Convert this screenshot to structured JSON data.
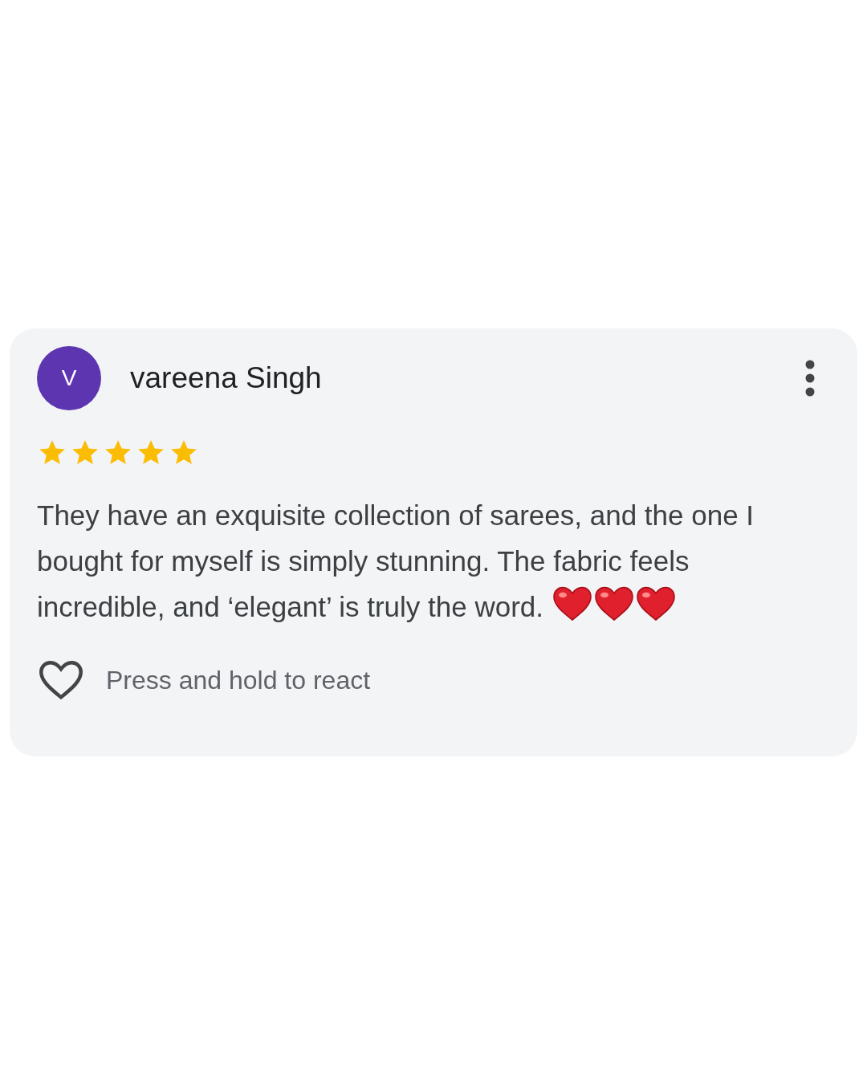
{
  "review": {
    "avatar_letter": "V",
    "author": "vareena Singh",
    "stars": 5,
    "text": "They have an exquisite collection of sarees, and the one I bought for myself is simply stunning. The fabric feels incredible, and ‘elegant’ is truly the word.",
    "emojis": [
      {
        "kind": "red-heart"
      },
      {
        "kind": "red-heart"
      },
      {
        "kind": "red-heart"
      }
    ],
    "react_hint": "Press and hold to react"
  }
}
